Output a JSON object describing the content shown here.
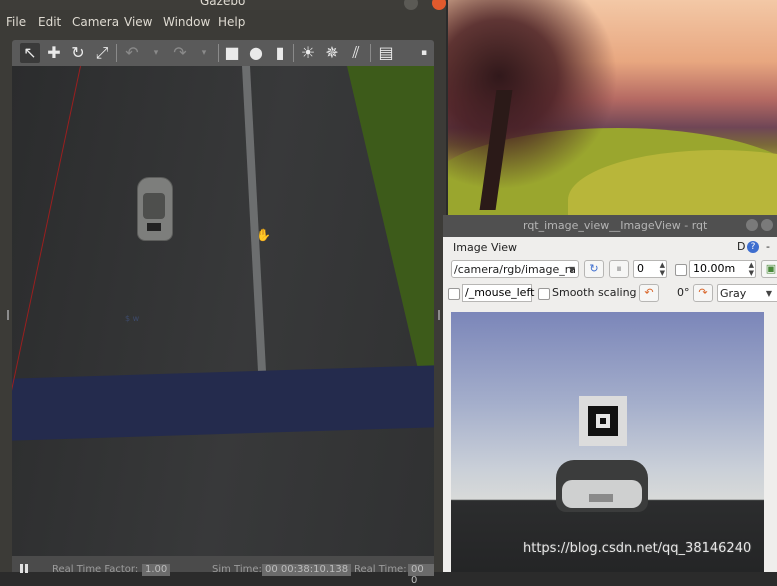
{
  "gazebo": {
    "title": "Gazebo",
    "menu": [
      "File",
      "Edit",
      "Camera",
      "View",
      "Window",
      "Help"
    ],
    "toolbar_icons": [
      "select-arrow-icon",
      "translate-icon",
      "rotate-icon",
      "scale-icon",
      "undo-icon",
      "redo-icon",
      "box-icon",
      "sphere-icon",
      "cylinder-icon",
      "point-light-icon",
      "spot-light-icon",
      "directional-light-icon",
      "copy-icon"
    ],
    "viewport": {
      "origin_label": "$ w"
    },
    "status": {
      "rtf_label": "Real Time Factor:",
      "rtf_value": "1.00",
      "sim_label": "Sim Time:",
      "sim_value": "00 00:38:10.138",
      "real_label": "Real Time:",
      "real_value": "00 0"
    }
  },
  "rqt": {
    "window_title": "rqt_image_view__ImageView - rqt",
    "plugin_title": "Image View",
    "plugin_d": "D",
    "plugin_help": "?",
    "plugin_dash": "-",
    "topic": "/camera/rgb/image_ra",
    "spin_value": "0",
    "distance": "10.00m",
    "mouse_topic": "/_mouse_left",
    "smooth_label": "Smooth scaling",
    "rotation": "0°",
    "colormap": "Gray"
  },
  "watermark": "https://blog.csdn.net/qq_38146240",
  "colors": {
    "accent_close": "#e25a2d",
    "help_blue": "#3e6ecf"
  }
}
